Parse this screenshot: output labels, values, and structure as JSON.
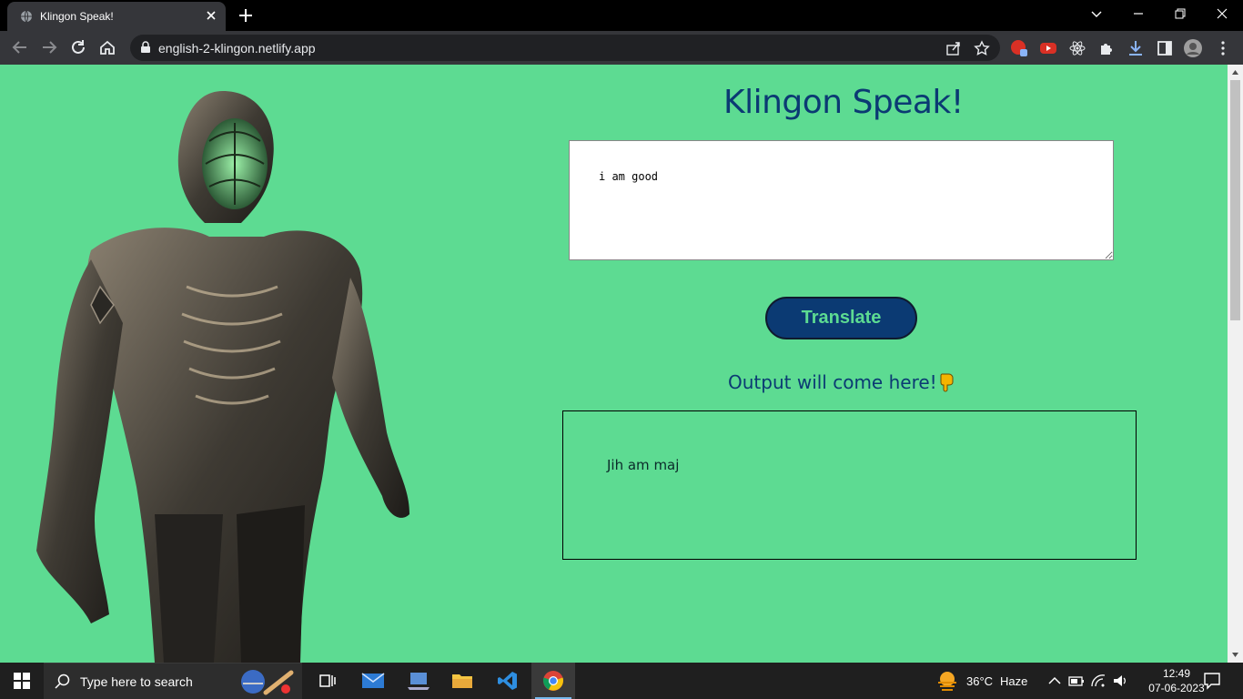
{
  "browser": {
    "tab_title": "Klingon Speak!",
    "url": "english-2-klingon.netlify.app"
  },
  "page": {
    "heading": "Klingon Speak!",
    "input_value": "i am good",
    "translate_label": "Translate",
    "output_heading": "Output will come here!",
    "output_text": "Jih am maj"
  },
  "taskbar": {
    "search_placeholder": "Type here to search",
    "weather_temp": "36°C",
    "weather_desc": "Haze",
    "time": "12:49",
    "date": "07-06-2023"
  },
  "colors": {
    "page_bg": "#5ddb92",
    "accent_dark": "#0b3a73"
  }
}
